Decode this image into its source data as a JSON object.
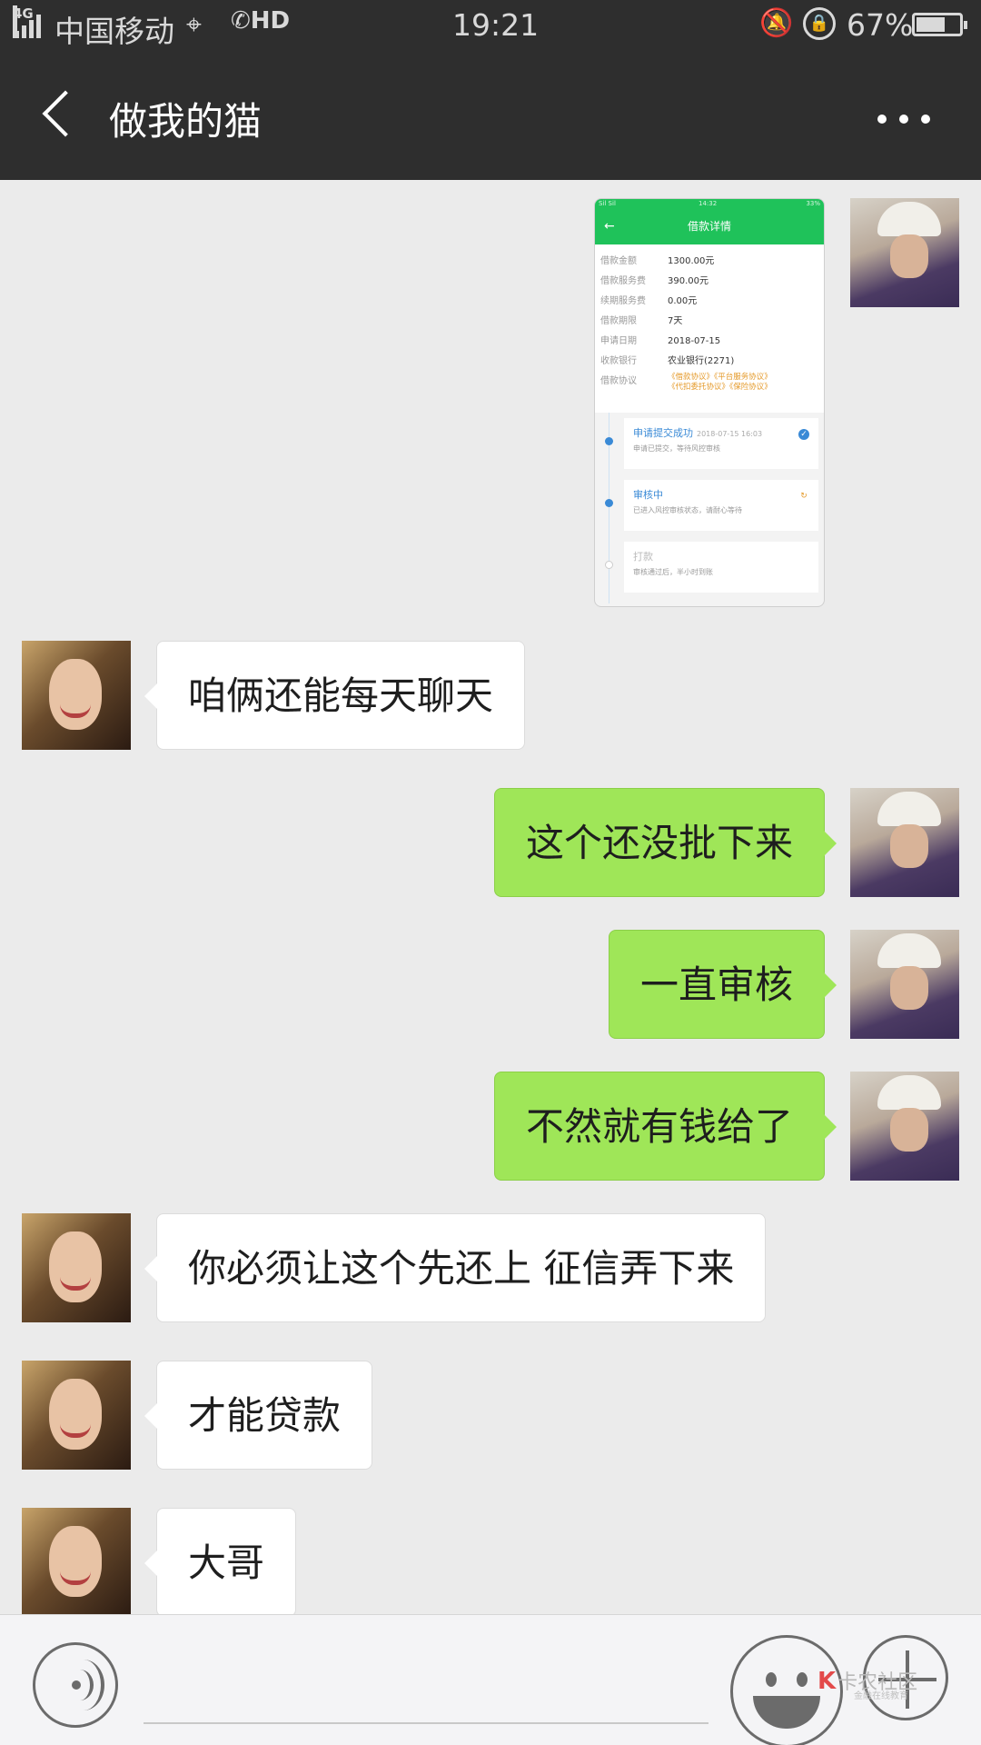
{
  "status_bar": {
    "network": "4G",
    "carrier": "中国移动",
    "hd": "HD",
    "time": "19:21",
    "battery_percent": "67%",
    "battery_level": 0.67
  },
  "header": {
    "title": "做我的猫"
  },
  "shared_screenshot": {
    "status_left": "Sil Sil",
    "status_center": "14:32",
    "status_right": "33%",
    "title": "借款详情",
    "details": [
      {
        "key": "借款金额",
        "value": "1300.00元"
      },
      {
        "key": "借款服务费",
        "value": "390.00元"
      },
      {
        "key": "续期服务费",
        "value": "0.00元"
      },
      {
        "key": "借款期限",
        "value": "7天"
      },
      {
        "key": "申请日期",
        "value": "2018-07-15"
      },
      {
        "key": "收款银行",
        "value": "农业银行(2271)"
      }
    ],
    "agreement_label": "借款协议",
    "agreement_links_1": "《借款协议》《平台服务协议》",
    "agreement_links_2": "《代扣委托协议》《保险协议》",
    "steps": [
      {
        "title": "申请提交成功",
        "time": "2018-07-15 16:03",
        "desc": "申请已提交，等待风控审核"
      },
      {
        "title": "审核中",
        "desc": "已进入风控审核状态，请耐心等待"
      },
      {
        "title": "打款",
        "desc": "审核通过后，半小时到账"
      }
    ]
  },
  "messages": [
    {
      "sender": "her",
      "text": "咱俩还能每天聊天"
    },
    {
      "sender": "me",
      "text": "这个还没批下来"
    },
    {
      "sender": "me",
      "text": "一直审核"
    },
    {
      "sender": "me",
      "text": "不然就有钱给了"
    },
    {
      "sender": "her",
      "text": "你必须让这个先还上   征信弄下来"
    },
    {
      "sender": "her",
      "text": "才能贷款"
    },
    {
      "sender": "her",
      "text": "大哥"
    }
  ],
  "watermark": {
    "title": "卡农社区",
    "subtitle": "金融在线教育"
  }
}
